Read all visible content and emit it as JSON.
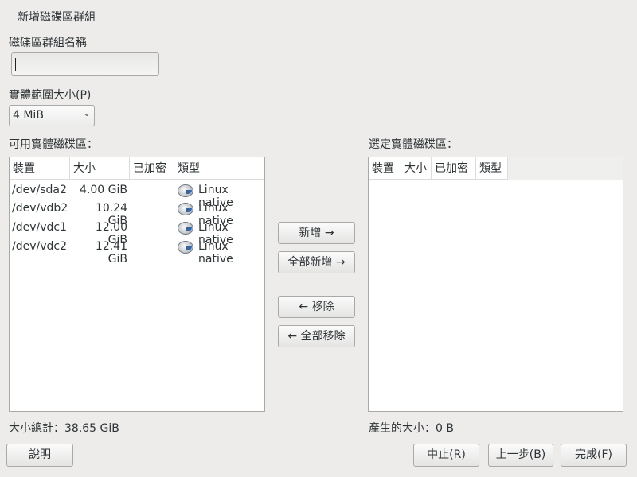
{
  "dialog": {
    "title": "新增磁碟區群組"
  },
  "name_field": {
    "label": "磁碟區群組名稱",
    "value": ""
  },
  "extent": {
    "label": "實體範圍大小(P)",
    "value": "4 MiB",
    "arrow_icon": "chevron-down-icon"
  },
  "available": {
    "label": "可用實體磁碟區：",
    "columns": [
      "裝置",
      "大小",
      "已加密",
      "類型"
    ],
    "rows": [
      {
        "device": "/dev/sda2",
        "size": "4.00 GiB",
        "encrypted": "",
        "type": "Linux native",
        "icon": "disk-icon"
      },
      {
        "device": "/dev/vdb2",
        "size": "10.24 GiB",
        "encrypted": "",
        "type": "Linux native",
        "icon": "disk-icon"
      },
      {
        "device": "/dev/vdc1",
        "size": "12.00 GiB",
        "encrypted": "",
        "type": "Linux native",
        "icon": "disk-icon"
      },
      {
        "device": "/dev/vdc2",
        "size": "12.41 GiB",
        "encrypted": "",
        "type": "Linux native",
        "icon": "disk-icon"
      }
    ],
    "total": "大小總計：38.65 GiB"
  },
  "selected": {
    "label": "選定實體磁碟區：",
    "columns": [
      "裝置",
      "大小",
      "已加密",
      "類型"
    ],
    "result": "產生的大小：0 B"
  },
  "transfer_buttons": {
    "add": "新增 →",
    "add_all": "全部新增 →",
    "remove": "← 移除",
    "remove_all": "← 全部移除"
  },
  "footer": {
    "help": "說明",
    "cancel": "中止(R)",
    "back": "上一步(B)",
    "finish": "完成(F)"
  }
}
